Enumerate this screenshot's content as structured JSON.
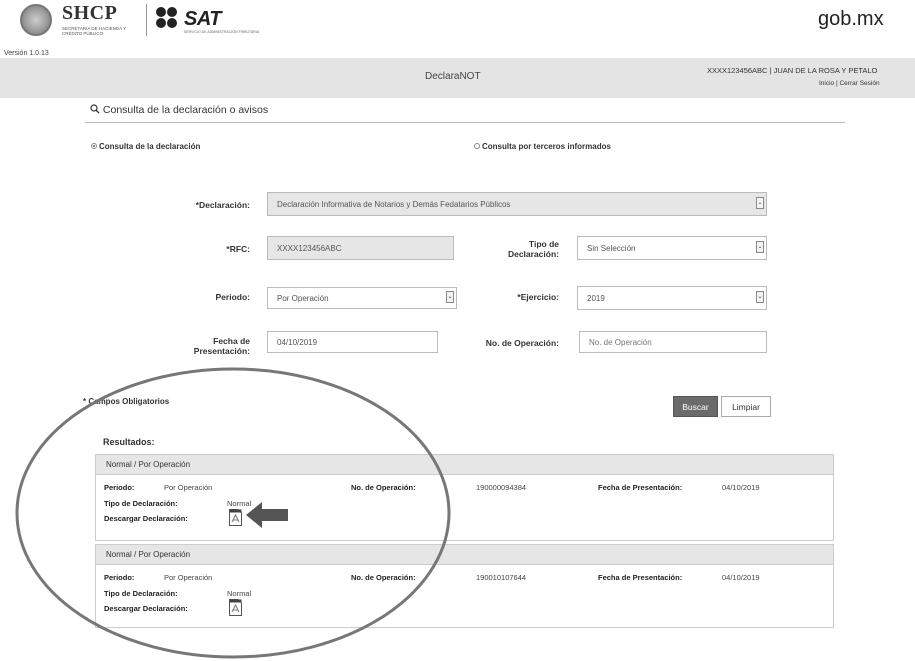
{
  "header": {
    "shcp_title": "SHCP",
    "shcp_subtitle": "SECRETARÍA DE HACIENDA Y CRÉDITO PÚBLICO",
    "sat_title": "SAT",
    "sat_subtitle": "SERVICIO DE ADMINISTRACIÓN TRIBUTARIA",
    "gob": "gob.mx",
    "version": "Versión 1.0.13"
  },
  "topbar": {
    "app_name": "DeclaraNOT",
    "user": "XXXX123456ABC  |  JUAN DE LA ROSA Y PETALO",
    "links": "Inicio | Cerrar Sesión"
  },
  "page": {
    "title": "Consulta de la declaración o avisos"
  },
  "radios": {
    "option1": "Consulta de la declaración",
    "option2": "Consulta por terceros informados",
    "selected": "option1"
  },
  "form": {
    "declaracion_label": "*Declaración:",
    "declaracion_value": "Declaración Informativa de Notarios y Demás Fedatarios Públicos",
    "rfc_label": "*RFC:",
    "rfc_value": "XXXX123456ABC",
    "tipo_label": "Tipo de Declaración:",
    "tipo_value": "Sin Selección",
    "periodo_label": "Periodo:",
    "periodo_value": "Por Operación",
    "ejercicio_label": "*Ejercicio:",
    "ejercicio_value": "2019",
    "fecha_label": "Fecha de Presentación:",
    "fecha_value": "04/10/2019",
    "noop_label": "No. de Operación:",
    "noop_placeholder": "No. de Operación",
    "required_note": "* Campos Obligatorios",
    "search_button": "Buscar",
    "clear_button": "Limpiar"
  },
  "results": {
    "label": "Resultados:",
    "items": [
      {
        "header": "Normal / Por Operación",
        "periodo_label": "Periodo:",
        "periodo_value": "Por Operación",
        "noop_label": "No. de Operación:",
        "noop_value": "190000094384",
        "fecha_label": "Fecha de Presentación:",
        "fecha_value": "04/10/2019",
        "tipo_label": "Tipo de Declaración:",
        "tipo_value": "Normal",
        "descargar_label": "Descargar Declaración:"
      },
      {
        "header": "Normal / Por Operación",
        "periodo_label": "Periodo:",
        "periodo_value": "Por Operación",
        "noop_label": "No. de Operación:",
        "noop_value": "190010107644",
        "fecha_label": "Fecha de Presentación:",
        "fecha_value": "04/10/2019",
        "tipo_label": "Tipo de Declaración:",
        "tipo_value": "Normal",
        "descargar_label": "Descargar Declaración:"
      }
    ]
  },
  "icons": {
    "search": "search-icon",
    "pdf": "pdf-icon",
    "dropdown": "chevron-down-icon"
  }
}
